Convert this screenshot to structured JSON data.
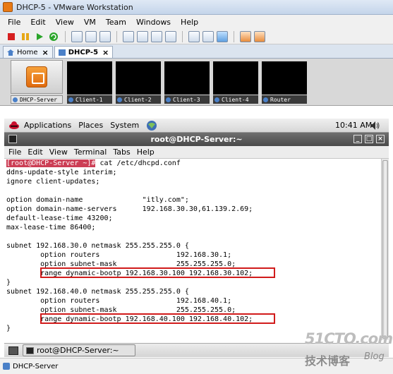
{
  "window": {
    "title": "DHCP-5 - VMware Workstation"
  },
  "menubar": [
    "File",
    "Edit",
    "View",
    "VM",
    "Team",
    "Windows",
    "Help"
  ],
  "tabs": [
    {
      "label": "Home",
      "active": false
    },
    {
      "label": "DHCP-5",
      "active": true
    }
  ],
  "thumbnails": [
    {
      "label": "DHCP-Server",
      "selected": true
    },
    {
      "label": "Client-1",
      "selected": false
    },
    {
      "label": "Client-2",
      "selected": false
    },
    {
      "label": "Client-3",
      "selected": false
    },
    {
      "label": "Client-4",
      "selected": false
    },
    {
      "label": "Router",
      "selected": false
    }
  ],
  "gnome_panel": {
    "applications": "Applications",
    "places": "Places",
    "system": "System",
    "clock": "10:41 AM"
  },
  "terminal": {
    "title": "root@DHCP-Server:~",
    "menu": [
      "File",
      "Edit",
      "View",
      "Terminal",
      "Tabs",
      "Help"
    ],
    "prompt": "[root@DHCP-Server ~]#",
    "command": " cat /etc/dhcpd.conf",
    "lines": [
      "ddns-update-style interim;",
      "ignore client-updates;",
      "",
      "option domain-name              \"itly.com\";",
      "option domain-name-servers      192.168.30.30,61.139.2.69;",
      "default-lease-time 43200;",
      "max-lease-time 86400;",
      "",
      "subnet 192.168.30.0 netmask 255.255.255.0 {",
      "        option routers                  192.168.30.1;",
      "        option subnet-mask              255.255.255.0;",
      "        range dynamic-bootp 192.168.30.100 192.168.30.102;",
      "}",
      "subnet 192.168.40.0 netmask 255.255.255.0 {",
      "        option routers                  192.168.40.1;",
      "        option subnet-mask              255.255.255.0;",
      "        range dynamic-bootp 192.168.40.100 192.168.40.102;",
      "}"
    ]
  },
  "taskbar": {
    "task": "root@DHCP-Server:~"
  },
  "statusbar": {
    "text": "DHCP-Server"
  },
  "watermark": {
    "main": "51CTO.com",
    "sub": "技术博客",
    "blog": "Blog"
  },
  "colors": {
    "prompt_bg": "#cc3e55",
    "highlight_box": "#d11b1b"
  }
}
